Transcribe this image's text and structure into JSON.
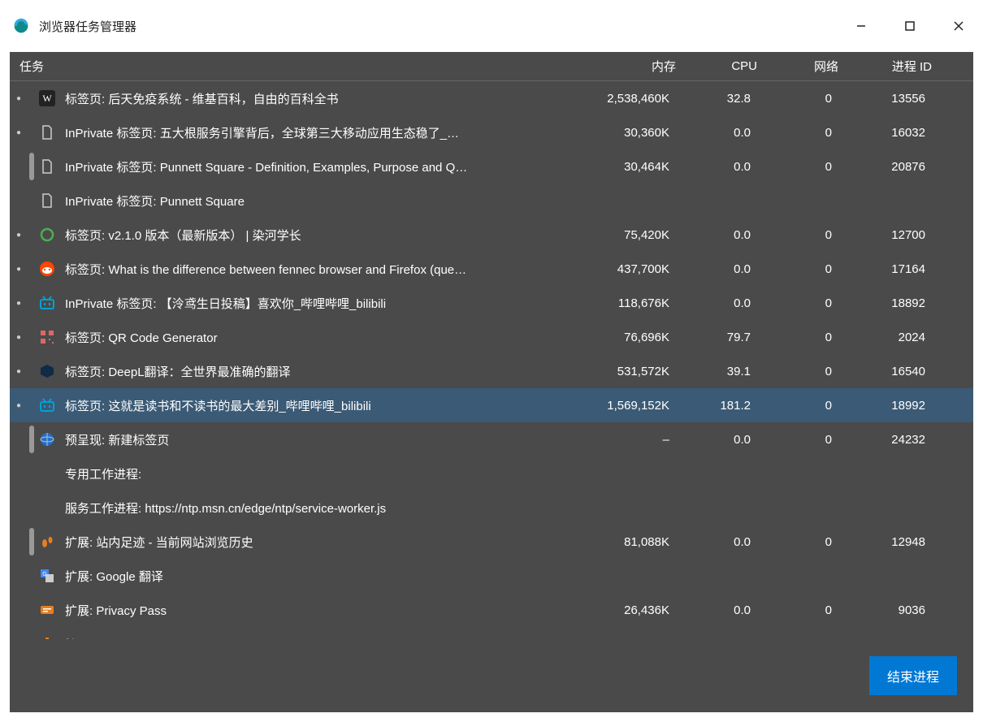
{
  "window": {
    "title": "浏览器任务管理器"
  },
  "columns": {
    "task": "任务",
    "mem": "内存",
    "cpu": "CPU",
    "net": "网络",
    "pid": "进程 ID"
  },
  "end_process": "结束进程",
  "tasks": [
    {
      "bullet": "●",
      "group": false,
      "icon": "wiki",
      "name": "标签页: 后天免疫系统 - 维基百科，自由的百科全书",
      "mem": "2,538,460K",
      "cpu": "32.8",
      "net": "0",
      "pid": "13556",
      "selected": false
    },
    {
      "bullet": "●",
      "group": false,
      "icon": "page",
      "name": "InPrivate 标签页: 五大根服务引擎背后，全球第三大移动应用生态稳了_…",
      "mem": "30,360K",
      "cpu": "0.0",
      "net": "0",
      "pid": "16032",
      "selected": false
    },
    {
      "bullet": "",
      "group": true,
      "icon": "page",
      "name": "InPrivate 标签页: Punnett Square - Definition, Examples, Purpose and Q…",
      "mem": "30,464K",
      "cpu": "0.0",
      "net": "0",
      "pid": "20876",
      "selected": false
    },
    {
      "bullet": "",
      "group": false,
      "icon": "page",
      "name": "InPrivate 标签页: Punnett Square",
      "mem": "",
      "cpu": "",
      "net": "",
      "pid": "",
      "selected": false
    },
    {
      "bullet": "●",
      "group": false,
      "icon": "circle",
      "name": "标签页: v2.1.0 版本（最新版本） | 染河学长",
      "mem": "75,420K",
      "cpu": "0.0",
      "net": "0",
      "pid": "12700",
      "selected": false
    },
    {
      "bullet": "●",
      "group": false,
      "icon": "reddit",
      "name": "标签页: What is the difference between fennec browser and Firefox (que…",
      "mem": "437,700K",
      "cpu": "0.0",
      "net": "0",
      "pid": "17164",
      "selected": false
    },
    {
      "bullet": "●",
      "group": false,
      "icon": "bili",
      "name": "InPrivate 标签页: 【泠鸢生日投稿】喜欢你_哔哩哔哩_bilibili",
      "mem": "118,676K",
      "cpu": "0.0",
      "net": "0",
      "pid": "18892",
      "selected": false
    },
    {
      "bullet": "●",
      "group": false,
      "icon": "qr",
      "name": "标签页: QR Code Generator",
      "mem": "76,696K",
      "cpu": "79.7",
      "net": "0",
      "pid": "2024",
      "selected": false
    },
    {
      "bullet": "●",
      "group": false,
      "icon": "deepl",
      "name": "标签页: DeepL翻译：全世界最准确的翻译",
      "mem": "531,572K",
      "cpu": "39.1",
      "net": "0",
      "pid": "16540",
      "selected": false
    },
    {
      "bullet": "●",
      "group": false,
      "icon": "bili",
      "name": "标签页: 这就是读书和不读书的最大差别_哔哩哔哩_bilibili",
      "mem": "1,569,152K",
      "cpu": "181.2",
      "net": "0",
      "pid": "18992",
      "selected": true
    },
    {
      "bullet": "",
      "group": true,
      "icon": "globe",
      "name": "预呈现: 新建标签页",
      "mem": "–",
      "cpu": "0.0",
      "net": "0",
      "pid": "24232",
      "selected": false
    },
    {
      "bullet": "",
      "group": false,
      "icon": "none",
      "name": "专用工作进程:",
      "mem": "",
      "cpu": "",
      "net": "",
      "pid": "",
      "selected": false
    },
    {
      "bullet": "",
      "group": false,
      "icon": "none",
      "name": "服务工作进程: https://ntp.msn.cn/edge/ntp/service-worker.js",
      "mem": "",
      "cpu": "",
      "net": "",
      "pid": "",
      "selected": false
    },
    {
      "bullet": "",
      "group": true,
      "icon": "feet",
      "name": "扩展: 站内足迹 - 当前网站浏览历史",
      "mem": "81,088K",
      "cpu": "0.0",
      "net": "0",
      "pid": "12948",
      "selected": false
    },
    {
      "bullet": "",
      "group": false,
      "icon": "gtrans",
      "name": "扩展: Google 翻译",
      "mem": "",
      "cpu": "",
      "net": "",
      "pid": "",
      "selected": false
    },
    {
      "bullet": "",
      "group": false,
      "icon": "ppass",
      "name": "扩展: Privacy Pass",
      "mem": "26,436K",
      "cpu": "0.0",
      "net": "0",
      "pid": "9036",
      "selected": false
    },
    {
      "bullet": "",
      "group": false,
      "icon": "trash",
      "name": "扩展: ClearURLs",
      "mem": "",
      "cpu": "",
      "net": "",
      "pid": "",
      "selected": false
    }
  ]
}
